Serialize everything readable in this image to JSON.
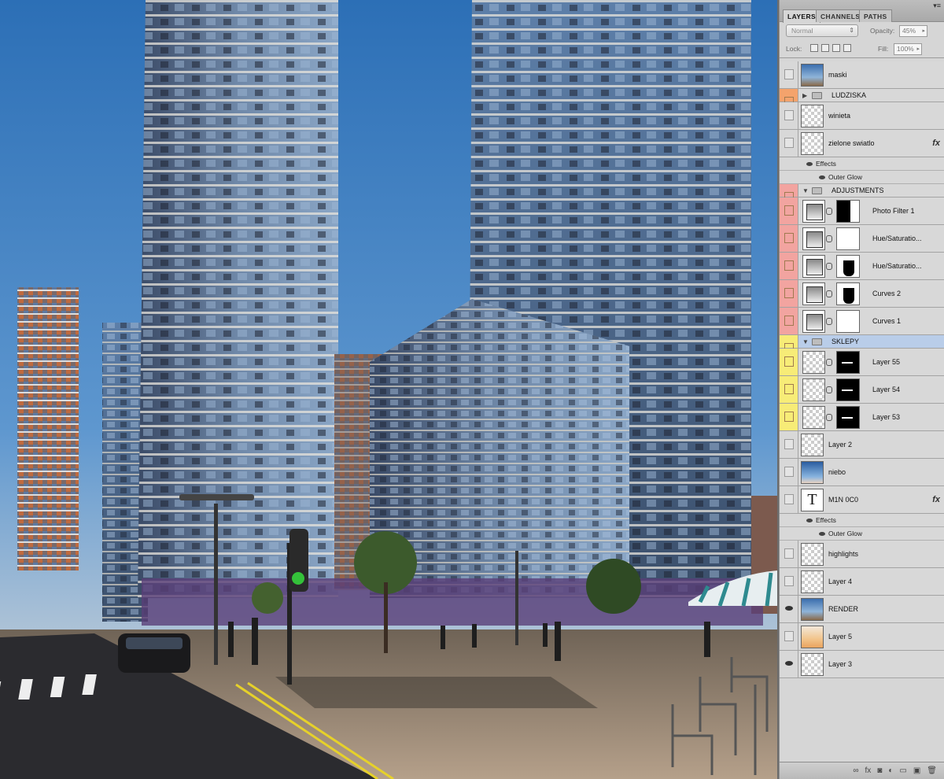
{
  "panel": {
    "tabs": [
      {
        "label": "LAYERS",
        "active": true
      },
      {
        "label": "CHANNELS",
        "active": false
      },
      {
        "label": "PATHS",
        "active": false
      }
    ],
    "blend_mode": "Normal",
    "opacity_label": "Opacity:",
    "opacity_value": "45%",
    "lock_label": "Lock:",
    "fill_label": "Fill:",
    "fill_value": "100%"
  },
  "layers": [
    {
      "name": "maski",
      "thumb": "photo",
      "visible": false
    },
    {
      "name": "LUDZISKA",
      "group": true,
      "expanded": false,
      "color": "orange"
    },
    {
      "name": "winieta",
      "thumb": "checker",
      "visible": false
    },
    {
      "name": "zielone swiatlo",
      "thumb": "checker",
      "fx": true,
      "effects_label": "Effects",
      "effects": [
        "Outer Glow"
      ]
    },
    {
      "name": "ADJUSTMENTS",
      "group": true,
      "expanded": true,
      "color": "red"
    },
    {
      "name": "Photo Filter 1",
      "thumb": "adj",
      "mask": "pf",
      "color": "red",
      "indent": true
    },
    {
      "name": "Hue/Saturatio...",
      "thumb": "adj",
      "mask": "white",
      "color": "red",
      "indent": true
    },
    {
      "name": "Hue/Saturatio...",
      "thumb": "adj",
      "mask": "hue",
      "color": "red",
      "indent": true
    },
    {
      "name": "Curves 2",
      "thumb": "adj",
      "mask": "hue",
      "color": "red",
      "indent": true
    },
    {
      "name": "Curves 1",
      "thumb": "adj",
      "mask": "white",
      "color": "red",
      "indent": true
    },
    {
      "name": "SKLEPY",
      "group": true,
      "expanded": true,
      "color": "yellow",
      "selected": true
    },
    {
      "name": "Layer 55",
      "thumb": "checker",
      "mask": "black",
      "color": "yellow",
      "indent": true
    },
    {
      "name": "Layer 54",
      "thumb": "checker",
      "mask": "black",
      "color": "yellow",
      "indent": true
    },
    {
      "name": "Layer 53",
      "thumb": "checker",
      "mask": "black",
      "color": "yellow",
      "indent": true
    },
    {
      "name": "Layer 2",
      "thumb": "checker"
    },
    {
      "name": "niebo",
      "thumb": "sky"
    },
    {
      "name": "M1N 0C0",
      "thumb": "textT",
      "thumb_text": "T",
      "fx": true,
      "effects_label": "Effects",
      "effects": [
        "Outer Glow"
      ]
    },
    {
      "name": "highlights",
      "thumb": "checker"
    },
    {
      "name": "Layer 4",
      "thumb": "checker"
    },
    {
      "name": "RENDER",
      "thumb": "photo",
      "visible": true
    },
    {
      "name": "Layer 5",
      "thumb": "sunset"
    },
    {
      "name": "Layer 3",
      "thumb": "checker",
      "visible": true
    }
  ],
  "bottom_icons": [
    "link-layers-icon",
    "fx-icon",
    "add-mask-icon",
    "adjustment-icon",
    "new-group-icon",
    "new-layer-icon",
    "trash-icon"
  ],
  "bottom_glyphs": [
    "∞",
    "fx",
    "◙",
    "◐",
    "▭",
    "▣",
    "🗑"
  ]
}
